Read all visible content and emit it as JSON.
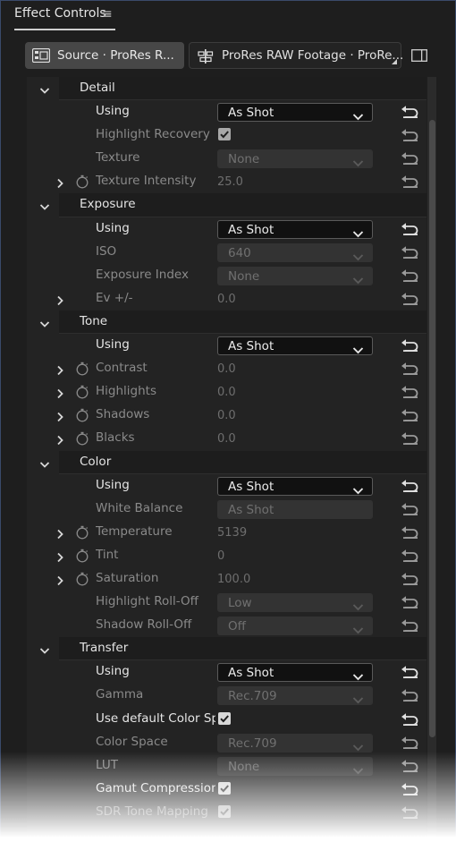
{
  "panel": {
    "title": "Effect Controls",
    "menu_glyph": "≡",
    "source_label": "Source · ProRes R...",
    "sequence_label": "ProRes RAW  Footage · ProRe...",
    "source_icon": "clip-icon",
    "sequence_icon": "sequence-icon",
    "toggle_icon": "panel-toggle-icon"
  },
  "colors": {
    "panel_bg": "#1e1e1e",
    "content_bg": "#232323",
    "active_text": "#e6e6e6",
    "disabled_text": "#8a8a8a",
    "dropdown_active_bg": "#111111",
    "dropdown_disabled_bg": "#333333"
  },
  "sections": [
    {
      "name": "Detail",
      "rows": [
        {
          "type": "dropdown",
          "label": "Using",
          "value": "As Shot",
          "enabled": true
        },
        {
          "type": "checkbox",
          "label": "Highlight Recovery",
          "checked": true,
          "enabled": false
        },
        {
          "type": "dropdown",
          "label": "Texture",
          "value": "None",
          "enabled": false
        },
        {
          "type": "param",
          "label": "Texture Intensity",
          "value": "25.0",
          "expand": true,
          "stopwatch": true
        }
      ]
    },
    {
      "name": "Exposure",
      "rows": [
        {
          "type": "dropdown",
          "label": "Using",
          "value": "As Shot",
          "enabled": true
        },
        {
          "type": "dropdown",
          "label": "ISO",
          "value": "640",
          "enabled": false
        },
        {
          "type": "dropdown",
          "label": "Exposure Index",
          "value": "None",
          "enabled": false
        },
        {
          "type": "param",
          "label": "Ev +/-",
          "value": "0.0",
          "expand": true,
          "stopwatch": false
        }
      ]
    },
    {
      "name": "Tone",
      "rows": [
        {
          "type": "dropdown",
          "label": "Using",
          "value": "As Shot",
          "enabled": true
        },
        {
          "type": "param",
          "label": "Contrast",
          "value": "0.0",
          "expand": true,
          "stopwatch": true
        },
        {
          "type": "param",
          "label": "Highlights",
          "value": "0.0",
          "expand": true,
          "stopwatch": true
        },
        {
          "type": "param",
          "label": "Shadows",
          "value": "0.0",
          "expand": true,
          "stopwatch": true
        },
        {
          "type": "param",
          "label": "Blacks",
          "value": "0.0",
          "expand": true,
          "stopwatch": true
        }
      ]
    },
    {
      "name": "Color",
      "rows": [
        {
          "type": "dropdown",
          "label": "Using",
          "value": "As Shot",
          "enabled": true
        },
        {
          "type": "dropdown",
          "label": "White Balance",
          "value": "As Shot",
          "enabled": false,
          "no_arrow": true
        },
        {
          "type": "param",
          "label": "Temperature",
          "value": "5139",
          "expand": true,
          "stopwatch": true
        },
        {
          "type": "param",
          "label": "Tint",
          "value": "0",
          "expand": true,
          "stopwatch": true
        },
        {
          "type": "param",
          "label": "Saturation",
          "value": "100.0",
          "expand": true,
          "stopwatch": true
        },
        {
          "type": "dropdown",
          "label": "Highlight Roll-Off",
          "value": "Low",
          "enabled": false
        },
        {
          "type": "dropdown",
          "label": "Shadow Roll-Off",
          "value": "Off",
          "enabled": false
        }
      ]
    },
    {
      "name": "Transfer",
      "rows": [
        {
          "type": "dropdown",
          "label": "Using",
          "value": "As Shot",
          "enabled": true
        },
        {
          "type": "dropdown",
          "label": "Gamma",
          "value": "Rec.709",
          "enabled": false
        },
        {
          "type": "checkbox",
          "label": "Use default Color Sp...",
          "checked": true,
          "enabled": true
        },
        {
          "type": "dropdown",
          "label": "Color Space",
          "value": "Rec.709",
          "enabled": false
        },
        {
          "type": "dropdown",
          "label": "LUT",
          "value": "None",
          "enabled": false
        },
        {
          "type": "checkbox",
          "label": "Gamut Compression",
          "checked": true,
          "enabled": true
        },
        {
          "type": "checkbox",
          "label": "SDR Tone Mapping",
          "checked": true,
          "enabled": false
        }
      ]
    }
  ]
}
